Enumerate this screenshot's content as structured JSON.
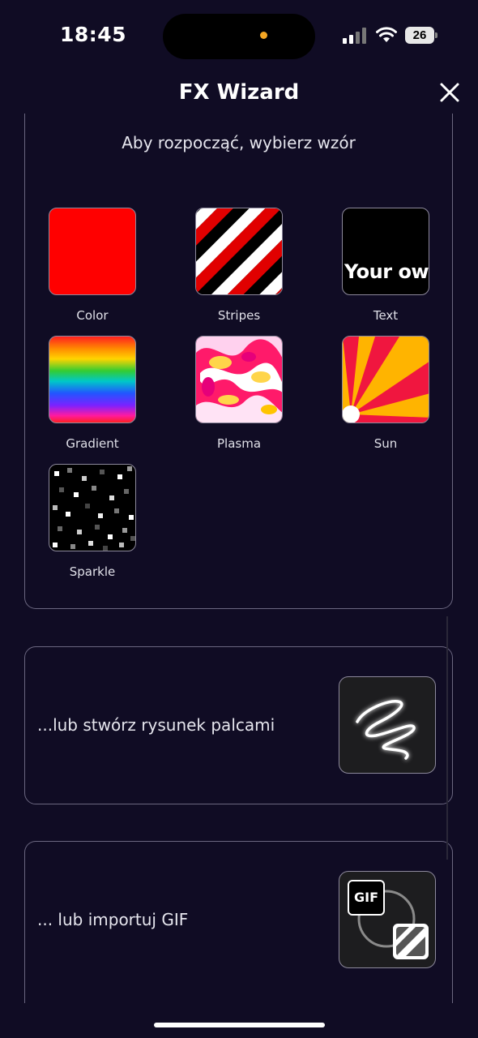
{
  "status": {
    "time": "18:45",
    "battery": "26"
  },
  "header": {
    "title": "FX Wizard"
  },
  "patterns": {
    "intro": "Aby rozpocząć, wybierz wzór",
    "items": [
      {
        "label": "Color",
        "icon": "solid-red-swatch"
      },
      {
        "label": "Stripes",
        "icon": "diagonal-stripes-swatch"
      },
      {
        "label": "Text",
        "icon": "text-swatch",
        "preview": "Your ow"
      },
      {
        "label": "Gradient",
        "icon": "rainbow-gradient-swatch"
      },
      {
        "label": "Plasma",
        "icon": "plasma-swatch"
      },
      {
        "label": "Sun",
        "icon": "sun-rays-swatch"
      },
      {
        "label": "Sparkle",
        "icon": "sparkle-swatch"
      }
    ]
  },
  "draw_option": {
    "label": "...lub stwórz rysunek palcami",
    "icon": "squiggle-drawing-icon"
  },
  "gif_option": {
    "label": "... lub importuj GIF",
    "icon": "gif-import-icon",
    "badge": "GIF"
  },
  "colors": {
    "background": "#100c24",
    "border": "#6b6780",
    "red": "#ff0000",
    "orange": "#f5a623"
  }
}
